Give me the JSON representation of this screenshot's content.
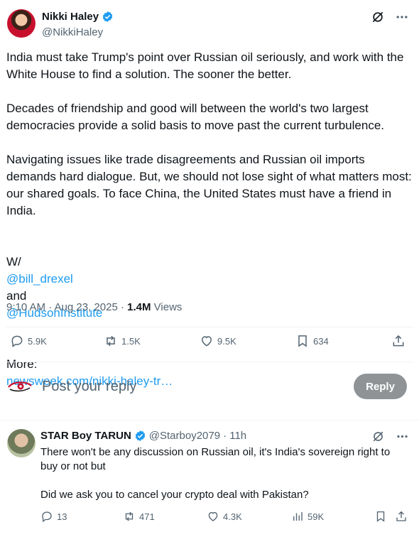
{
  "tweet": {
    "author_name": "Nikki Haley",
    "author_handle": "@NikkiHaley",
    "paragraphs": [
      "India must take Trump's point over Russian oil seriously, and work with the White House to find a solution. The sooner the better.",
      "Decades of friendship and good will between the world's two largest democracies provide a solid basis to move past the current turbulence.",
      "Navigating issues like trade disagreements and Russian oil imports demands hard dialogue. But, we should not lose sight of what matters most: our shared goals. To face China, the United States must have a friend in India."
    ],
    "with_prefix": "W/",
    "mention_1": "@bill_drexel",
    "with_and": "and",
    "mention_2": "@HudsonInstitute",
    "more_prefix": "More:",
    "more_link": "newsweek.com/nikki-haley-tr…",
    "timestamp": "9:10 AM · Aug 23, 2025 ·",
    "views_count": "1.4M",
    "views_label": "Views",
    "replies": "5.9K",
    "reposts": "1.5K",
    "likes": "9.5K",
    "bookmarks": "634"
  },
  "composer": {
    "placeholder": "Post your reply",
    "button_label": "Reply"
  },
  "reply": {
    "author_name": "STAR Boy TARUN",
    "author_handle": "@Starboy2079",
    "time": "· 11h",
    "text_1": "There won't be any discussion on Russian oil, it's India's sovereign right to buy or not but",
    "text_2": "Did we ask you to cancel your crypto deal with Pakistan?",
    "replies": "13",
    "reposts": "471",
    "likes": "4.3K",
    "views": "59K"
  },
  "colors": {
    "link": "#1d9bf0",
    "verified": "#1d9bf0",
    "muted": "#536471",
    "reply_button": "#8f9396"
  },
  "icons": [
    "verified-badge-icon",
    "grok-icon",
    "more-icon",
    "reply-icon",
    "repost-icon",
    "like-icon",
    "bookmark-icon",
    "share-icon",
    "views-icon",
    "eye-logo-icon"
  ]
}
